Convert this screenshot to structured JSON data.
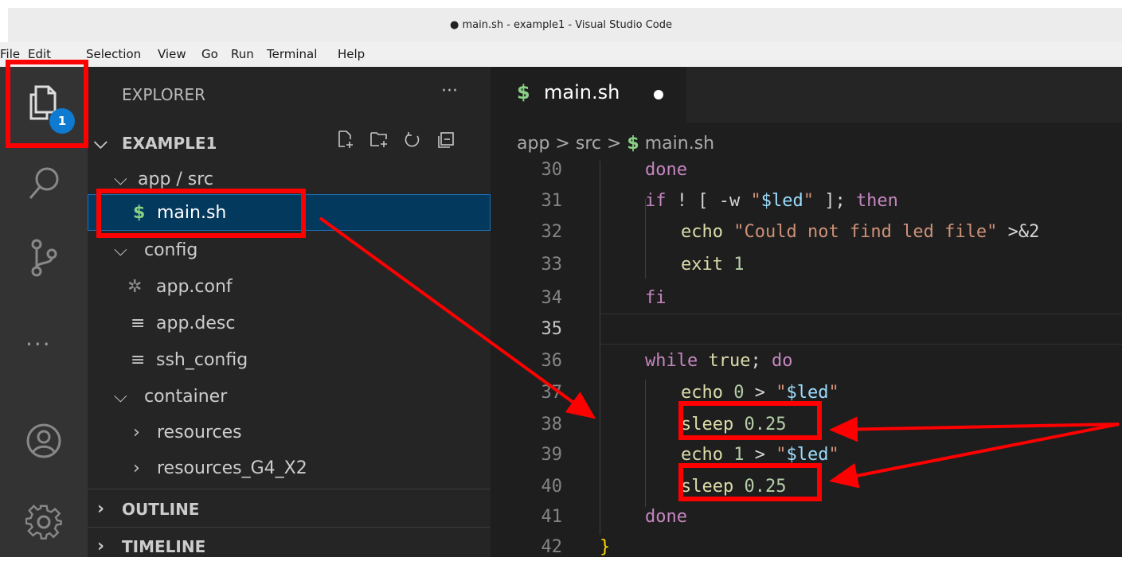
{
  "window": {
    "title": "● main.sh - example1 - Visual Studio Code"
  },
  "menu": [
    "File",
    "Edit",
    "Selection",
    "View",
    "Go",
    "Run",
    "Terminal",
    "Help"
  ],
  "activity_bar": {
    "explorer_badge": "1",
    "more": "···"
  },
  "explorer": {
    "title": "EXPLORER",
    "more": "···",
    "workspace": "EXAMPLE1",
    "tree": {
      "app_src": "app / src",
      "main_sh": "main.sh",
      "config": "config",
      "app_conf": "app.conf",
      "app_desc": "app.desc",
      "ssh_config": "ssh_config",
      "container": "container",
      "resources": "resources",
      "resources_g4": "resources_G4_X2"
    },
    "outline": "OUTLINE",
    "timeline": "TIMELINE"
  },
  "editor": {
    "tab": {
      "icon": "$",
      "name": "main.sh"
    },
    "breadcrumb": {
      "part1": "app",
      "sep": ">",
      "part2": "src",
      "icon": "$",
      "file": "main.sh"
    },
    "line_numbers": [
      "30",
      "31",
      "32",
      "33",
      "34",
      "35",
      "36",
      "37",
      "38",
      "39",
      "40",
      "41",
      "42"
    ],
    "current_line": "35"
  },
  "colors": {
    "accent": "#0e7ad2",
    "annotation": "#ff0000",
    "selection": "#04395e",
    "shell_icon": "#89d185"
  }
}
